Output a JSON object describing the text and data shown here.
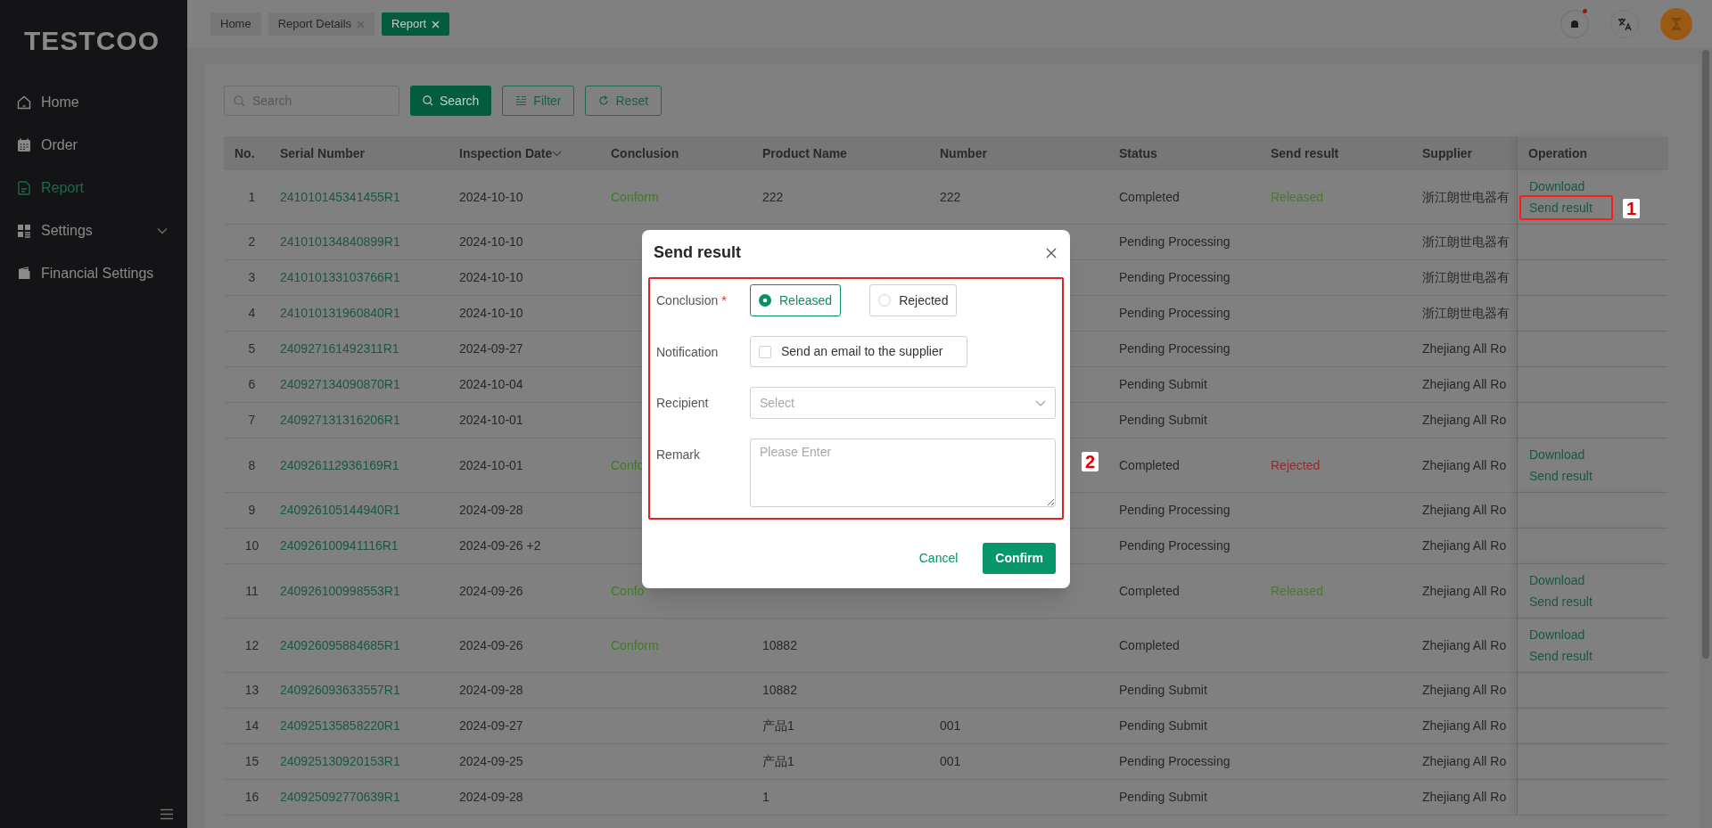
{
  "sidebar": {
    "logo": "TESTCOO",
    "items": [
      {
        "label": "Home",
        "kind": "home",
        "selected": false,
        "expandable": false
      },
      {
        "label": "Order",
        "kind": "calendar",
        "selected": false,
        "expandable": false
      },
      {
        "label": "Report",
        "kind": "document",
        "selected": true,
        "expandable": false
      },
      {
        "label": "Settings",
        "kind": "grid",
        "selected": false,
        "expandable": true
      },
      {
        "label": "Financial Settings",
        "kind": "wallet",
        "selected": false,
        "expandable": false
      }
    ]
  },
  "tabs": [
    {
      "label": "Home",
      "closable": false,
      "selected": false
    },
    {
      "label": "Report Details",
      "closable": true,
      "selected": false
    },
    {
      "label": "Report",
      "closable": true,
      "selected": true
    }
  ],
  "header": {
    "has_notification": true
  },
  "toolbar": {
    "search": {
      "placeholder": "Search"
    },
    "buttons": [
      {
        "label": "Search",
        "kind": "primary"
      },
      {
        "label": "Filter",
        "kind": "filter"
      },
      {
        "label": "Reset",
        "kind": "reset"
      }
    ]
  },
  "table": {
    "columns": [
      {
        "label": "No.",
        "sortable": false
      },
      {
        "label": "Serial Number",
        "sortable": false
      },
      {
        "label": "Inspection Date",
        "sortable": true
      },
      {
        "label": "Conclusion",
        "sortable": false
      },
      {
        "label": "Product Name",
        "sortable": false
      },
      {
        "label": "Number",
        "sortable": false
      },
      {
        "label": "Status",
        "sortable": false
      },
      {
        "label": "Send result",
        "sortable": false
      },
      {
        "label": "Supplier",
        "sortable": false
      },
      {
        "label": "Operation",
        "sortable": false
      }
    ],
    "rows": [
      {
        "no": "1",
        "serial": "241010145341455R1",
        "date": "2024-10-10",
        "conclusion": "Conform",
        "product": "222",
        "number": "222",
        "status": "Completed",
        "send_result": {
          "text": "Released",
          "kind": "released"
        },
        "supplier": "浙江朗世电器有",
        "operations": [
          {
            "label": "Download",
            "highlighted": false
          },
          {
            "label": "Send result",
            "highlighted": true,
            "annotation": "1"
          }
        ]
      },
      {
        "no": "2",
        "serial": "241010134840899R1",
        "date": "2024-10-10",
        "status": "Pending Processing",
        "supplier": "浙江朗世电器有"
      },
      {
        "no": "3",
        "serial": "241010133103766R1",
        "date": "2024-10-10",
        "status": "Pending Processing",
        "supplier": "浙江朗世电器有"
      },
      {
        "no": "4",
        "serial": "241010131960840R1",
        "date": "2024-10-10",
        "status": "Pending Processing",
        "supplier": "浙江朗世电器有"
      },
      {
        "no": "5",
        "serial": "240927161492311R1",
        "date": "2024-09-27",
        "status": "Pending Processing",
        "supplier": "Zhejiang All Ro"
      },
      {
        "no": "6",
        "serial": "240927134090870R1",
        "date": "2024-10-04",
        "status": "Pending Submit",
        "supplier": "Zhejiang All Ro"
      },
      {
        "no": "7",
        "serial": "240927131316206R1",
        "date": "2024-10-01",
        "status": "Pending Submit",
        "supplier": "Zhejiang All Ro"
      },
      {
        "no": "8",
        "serial": "240926112936169R1",
        "date": "2024-10-01",
        "conclusion": "Confo",
        "status": "Completed",
        "send_result": {
          "text": "Rejected",
          "kind": "rejected"
        },
        "supplier": "Zhejiang All Ro",
        "operations": [
          {
            "label": "Download",
            "highlighted": false
          },
          {
            "label": "Send result",
            "highlighted": false
          }
        ]
      },
      {
        "no": "9",
        "serial": "240926105144940R1",
        "date": "2024-09-28",
        "status": "Pending Processing",
        "supplier": "Zhejiang All Ro"
      },
      {
        "no": "10",
        "serial": "240926100941116R1",
        "date": "2024-09-26 +2",
        "status": "Pending Processing",
        "supplier": "Zhejiang All Ro"
      },
      {
        "no": "11",
        "serial": "240926100998553R1",
        "date": "2024-09-26",
        "conclusion": "Confo",
        "status": "Completed",
        "send_result": {
          "text": "Released",
          "kind": "released"
        },
        "supplier": "Zhejiang All Ro",
        "operations": [
          {
            "label": "Download",
            "highlighted": false
          },
          {
            "label": "Send result",
            "highlighted": false
          }
        ]
      },
      {
        "no": "12",
        "serial": "240926095884685R1",
        "date": "2024-09-26",
        "conclusion": "Conform",
        "product": "10882",
        "status": "Completed",
        "supplier": "Zhejiang All Ro",
        "operations": [
          {
            "label": "Download",
            "highlighted": false
          },
          {
            "label": "Send result",
            "highlighted": false
          }
        ]
      },
      {
        "no": "13",
        "serial": "240926093633557R1",
        "date": "2024-09-28",
        "product": "10882",
        "status": "Pending Submit",
        "supplier": "Zhejiang All Ro"
      },
      {
        "no": "14",
        "serial": "240925135858220R1",
        "date": "2024-09-27",
        "product": "产品1",
        "number": "001",
        "status": "Pending Submit",
        "supplier": "Zhejiang All Ro"
      },
      {
        "no": "15",
        "serial": "240925130920153R1",
        "date": "2024-09-25",
        "product": "产品1",
        "number": "001",
        "status": "Pending Processing",
        "supplier": "Zhejiang All Ro"
      },
      {
        "no": "16",
        "serial": "240925092770639R1",
        "date": "2024-09-28",
        "product": "1",
        "status": "Pending Submit",
        "supplier": "Zhejiang All Ro"
      }
    ]
  },
  "dialog": {
    "title": "Send result",
    "highlighted": true,
    "annotation": "2",
    "fields": [
      {
        "kind": "radio",
        "label": "Conclusion",
        "required_mark": "*",
        "options": [
          {
            "label": "Released",
            "selected": true
          },
          {
            "label": "Rejected",
            "selected": false
          }
        ]
      },
      {
        "kind": "checkbox",
        "label": "Notification",
        "option": {
          "label": "Send an email to the supplier",
          "checked": false
        }
      },
      {
        "kind": "select",
        "label": "Recipient",
        "placeholder": "Select"
      },
      {
        "kind": "textarea",
        "label": "Remark",
        "placeholder": "Please Enter"
      }
    ],
    "buttons": [
      {
        "label": "Cancel",
        "kind": "text"
      },
      {
        "label": "Confirm",
        "kind": "primary"
      }
    ]
  }
}
